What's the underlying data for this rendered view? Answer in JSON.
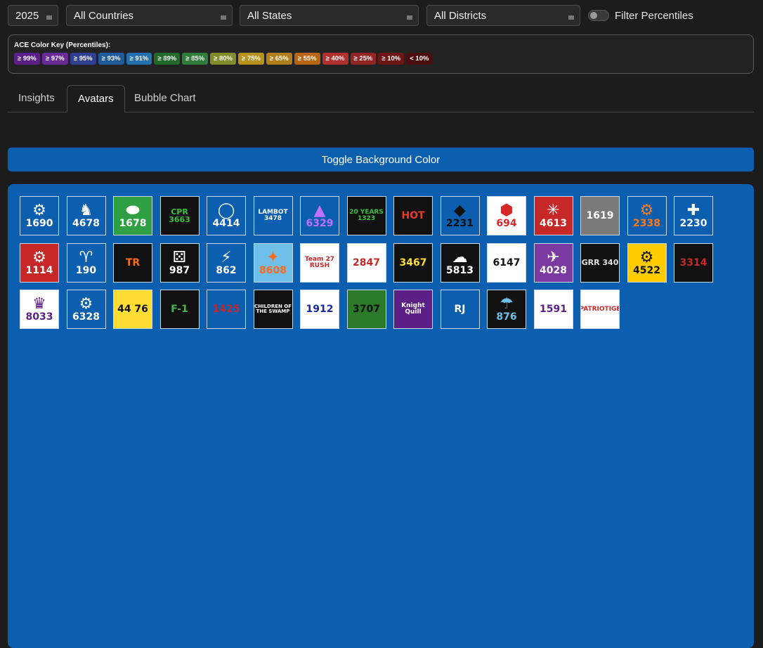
{
  "filters": {
    "year": "2025",
    "country": "All Countries",
    "state": "All States",
    "district": "All Districts",
    "percentile_toggle_label": "Filter Percentiles"
  },
  "color_key": {
    "title": "ACE Color Key (Percentiles):",
    "chips": [
      {
        "label": "≥ 99%",
        "color": "#5b1f86"
      },
      {
        "label": "≥ 97%",
        "color": "#6a2a96"
      },
      {
        "label": "≥ 95%",
        "color": "#2f3f91"
      },
      {
        "label": "≥ 93%",
        "color": "#1f5a9a"
      },
      {
        "label": "≥ 91%",
        "color": "#2370b0"
      },
      {
        "label": "≥ 89%",
        "color": "#226a2c"
      },
      {
        "label": "≥ 85%",
        "color": "#2f7d3a"
      },
      {
        "label": "≥ 80%",
        "color": "#7f8e2a"
      },
      {
        "label": "≥ 75%",
        "color": "#b8901c"
      },
      {
        "label": "≥ 65%",
        "color": "#b27e1a"
      },
      {
        "label": "≥ 55%",
        "color": "#b7650f"
      },
      {
        "label": "≥ 40%",
        "color": "#b22f2f"
      },
      {
        "label": "≥ 25%",
        "color": "#922424"
      },
      {
        "label": "≥ 10%",
        "color": "#6e1616"
      },
      {
        "label": "< 10%",
        "color": "#4a0e0e"
      }
    ]
  },
  "tabs": [
    {
      "label": "Insights"
    },
    {
      "label": "Avatars"
    },
    {
      "label": "Bubble Chart"
    }
  ],
  "toggle_button_label": "Toggle Background Color",
  "avatars": [
    {
      "text": "1690",
      "icon": "robot-icon",
      "bg": "#0b5fae",
      "fg": "#ffffff"
    },
    {
      "text": "4678",
      "icon": "horse-icon",
      "bg": "#0b5fae",
      "fg": "#ffffff"
    },
    {
      "text": "1678",
      "icon": "football-icon",
      "bg": "#2ea043",
      "fg": "#ffffff"
    },
    {
      "text": "CPR 3663",
      "icon": "text-icon",
      "bg": "#111111",
      "fg": "#3fbf3f"
    },
    {
      "text": "4414",
      "icon": "circle-icon",
      "bg": "#0b5fae",
      "fg": "#ffffff"
    },
    {
      "text": "LAMBOT 3478",
      "icon": "text-icon",
      "bg": "#0b5fae",
      "fg": "#ffffff"
    },
    {
      "text": "6329",
      "icon": "mountain-icon",
      "bg": "#0b5fae",
      "fg": "#c070ff"
    },
    {
      "text": "20 YEARS 1323",
      "icon": "text-icon",
      "bg": "#111111",
      "fg": "#3fbf3f"
    },
    {
      "text": "HOT",
      "icon": "text-icon",
      "bg": "#111111",
      "fg": "#e83a2a"
    },
    {
      "text": "2231",
      "icon": "penguin-icon",
      "bg": "#0b5fae",
      "fg": "#111111"
    },
    {
      "text": "694",
      "icon": "badge-icon",
      "bg": "#ffffff",
      "fg": "#d62828"
    },
    {
      "text": "4613",
      "icon": "spider-icon",
      "bg": "#c62828",
      "fg": "#ffffff"
    },
    {
      "text": "1619",
      "icon": "text-icon",
      "bg": "#7a7a7a",
      "fg": "#ffffff"
    },
    {
      "text": "2338",
      "icon": "gear-icon",
      "bg": "#0b5fae",
      "fg": "#ff7a1a"
    },
    {
      "text": "2230",
      "icon": "wrench-icon",
      "bg": "#0b5fae",
      "fg": "#ffffff"
    },
    {
      "text": "1114",
      "icon": "robot-icon",
      "bg": "#c62828",
      "fg": "#ffffff"
    },
    {
      "text": "190",
      "icon": "goat-icon",
      "bg": "#0b5fae",
      "fg": "#ffffff"
    },
    {
      "text": "TR",
      "icon": "text-icon",
      "bg": "#111111",
      "fg": "#ff6a1a"
    },
    {
      "text": "987",
      "icon": "dice-icon",
      "bg": "#111111",
      "fg": "#ffffff"
    },
    {
      "text": "862",
      "icon": "lightning-icon",
      "bg": "#0b5fae",
      "fg": "#ffffff"
    },
    {
      "text": "8608",
      "icon": "stingray-icon",
      "bg": "#6fc0e8",
      "fg": "#ff6a1a"
    },
    {
      "text": "Team 27 RUSH",
      "icon": "text-icon",
      "bg": "#ffffff",
      "fg": "#c62828"
    },
    {
      "text": "2847",
      "icon": "text-icon",
      "bg": "#ffffff",
      "fg": "#c62828"
    },
    {
      "text": "3467",
      "icon": "text-icon",
      "bg": "#111111",
      "fg": "#ffdd33"
    },
    {
      "text": "5813",
      "icon": "cloud-icon",
      "bg": "#111111",
      "fg": "#ffffff"
    },
    {
      "text": "6147",
      "icon": "text-icon",
      "bg": "#ffffff",
      "fg": "#111111"
    },
    {
      "text": "4028",
      "icon": "eagle-icon",
      "bg": "#7a3aa0",
      "fg": "#ffffff"
    },
    {
      "text": "GRR 340",
      "icon": "text-icon",
      "bg": "#111111",
      "fg": "#e0e0e0"
    },
    {
      "text": "4522",
      "icon": "gear-icon",
      "bg": "#ffcc00",
      "fg": "#111111"
    },
    {
      "text": "3314",
      "icon": "text-icon",
      "bg": "#111111",
      "fg": "#c62828"
    },
    {
      "text": "8033",
      "icon": "cat-icon",
      "bg": "#ffffff",
      "fg": "#5b1f86"
    },
    {
      "text": "6328",
      "icon": "gear-icon",
      "bg": "#0b5fae",
      "fg": "#ffffff"
    },
    {
      "text": "44 76",
      "icon": "text-icon",
      "bg": "#ffdd33",
      "fg": "#111111"
    },
    {
      "text": "F-1",
      "icon": "text-icon",
      "bg": "#111111",
      "fg": "#4caf50"
    },
    {
      "text": "1425",
      "icon": "text-icon",
      "bg": "#0b5fae",
      "fg": "#c62828"
    },
    {
      "text": "CHILDREN OF THE SWAMP",
      "icon": "text-icon",
      "bg": "#111111",
      "fg": "#ffffff"
    },
    {
      "text": "1912",
      "icon": "text-icon",
      "bg": "#ffffff",
      "fg": "#1a2aa0"
    },
    {
      "text": "3707",
      "icon": "text-icon",
      "bg": "#2a7a2a",
      "fg": "#111111"
    },
    {
      "text": "Knight Quill",
      "icon": "text-icon",
      "bg": "#5b1f86",
      "fg": "#ffffff"
    },
    {
      "text": "RJ",
      "icon": "text-icon",
      "bg": "#0b5fae",
      "fg": "#ffffff"
    },
    {
      "text": "876",
      "icon": "storm-icon",
      "bg": "#111111",
      "fg": "#6fc0e8"
    },
    {
      "text": "1591",
      "icon": "text-icon",
      "bg": "#ffffff",
      "fg": "#5b1f86"
    },
    {
      "text": "PATRIOTIGE",
      "icon": "text-icon",
      "bg": "#ffffff",
      "fg": "#c62828"
    }
  ]
}
